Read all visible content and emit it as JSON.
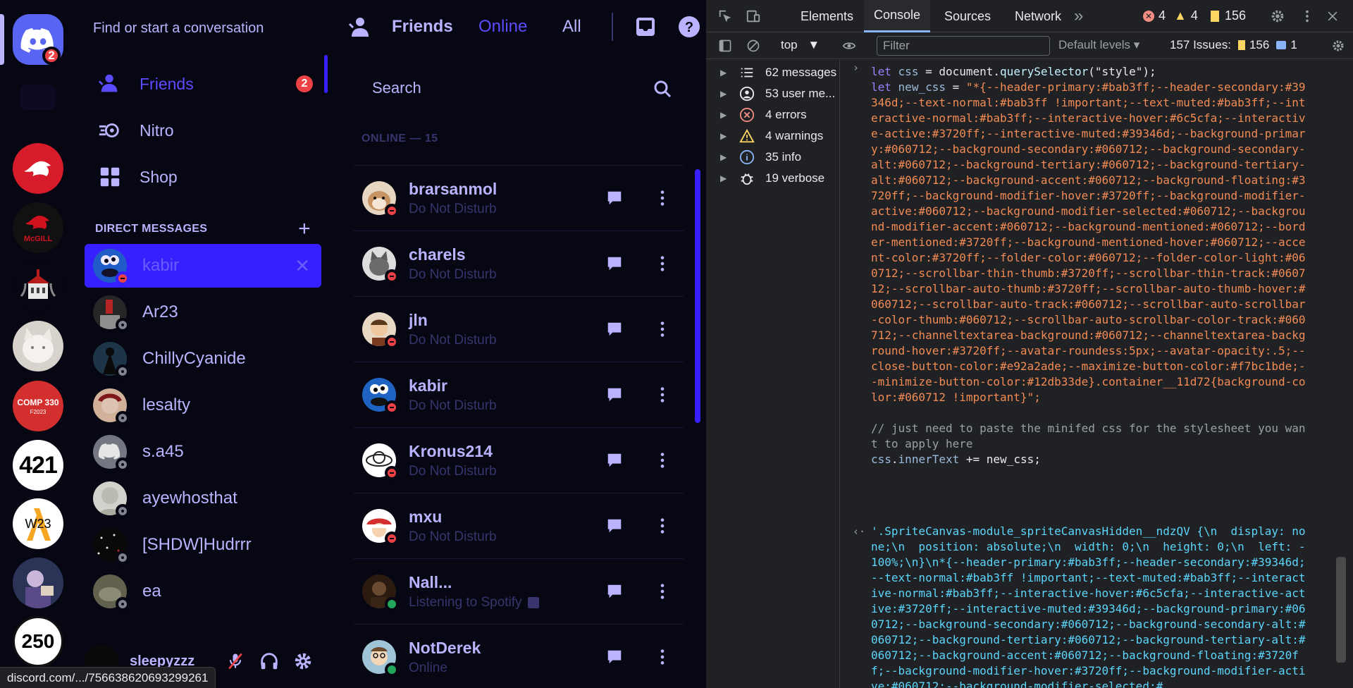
{
  "guilds": {
    "home_badge": "2",
    "comp_label": "COMP 330",
    "comp_sub": "F2023",
    "g421": "421",
    "w23": "W23",
    "g250": "250",
    "mcgill": "McGILL"
  },
  "channels": {
    "search_placeholder": "Find or start a conversation",
    "nav": [
      {
        "label": "Friends",
        "badge": "2"
      },
      {
        "label": "Nitro"
      },
      {
        "label": "Shop"
      }
    ],
    "dm_header": "DIRECT MESSAGES",
    "dm_add": "+",
    "dms": [
      {
        "name": "kabir",
        "status": "dnd",
        "selected": true
      },
      {
        "name": "Ar23",
        "status": "offline"
      },
      {
        "name": "ChillyCyanide",
        "status": "offline"
      },
      {
        "name": "lesalty",
        "status": "offline"
      },
      {
        "name": "s.a45",
        "status": "offline"
      },
      {
        "name": "ayewhosthat",
        "status": "offline"
      },
      {
        "name": "[SHDW]Hudrrr",
        "status": "offline"
      },
      {
        "name": "ea",
        "status": "offline"
      }
    ],
    "close_glyph": "✕"
  },
  "user_panel": {
    "username": "sleepyzzz"
  },
  "friends": {
    "title": "Friends",
    "tabs": [
      "Online",
      "All"
    ],
    "search_placeholder": "Search",
    "online_count_label": "ONLINE — 15",
    "list": [
      {
        "name": "brarsanmol",
        "status_text": "Do Not Disturb",
        "status": "dnd"
      },
      {
        "name": "charels",
        "status_text": "Do Not Disturb",
        "status": "dnd"
      },
      {
        "name": "jln",
        "status_text": "Do Not Disturb",
        "status": "dnd"
      },
      {
        "name": "kabir",
        "status_text": "Do Not Disturb",
        "status": "dnd"
      },
      {
        "name": "Kronus214",
        "status_text": "Do Not Disturb",
        "status": "dnd"
      },
      {
        "name": "mxu",
        "status_text": "Do Not Disturb",
        "status": "dnd"
      },
      {
        "name": "Nall...",
        "status_text": "Listening to Spotify",
        "status": "online"
      },
      {
        "name": "NotDerek",
        "status_text": "Online",
        "status": "online"
      }
    ]
  },
  "devtools": {
    "tabs": [
      "Elements",
      "Console",
      "Sources",
      "Network"
    ],
    "active_tab": "Console",
    "more_tabs": "»",
    "error_count": "4",
    "warning_count": "4",
    "issue_count": "156",
    "context": "top",
    "filter_placeholder": "Filter",
    "levels": "Default levels ▾",
    "issues_label": "157 Issues:",
    "issues_warn": "156",
    "issues_info": "1",
    "sidebar": [
      {
        "label": "62 messages",
        "icon": "list-icon"
      },
      {
        "label": "53 user me...",
        "icon": "user-icon"
      },
      {
        "label": "4 errors",
        "icon": "error-icon"
      },
      {
        "label": "4 warnings",
        "icon": "warning-icon"
      },
      {
        "label": "35 info",
        "icon": "info-icon"
      },
      {
        "label": "19 verbose",
        "icon": "bug-icon"
      }
    ],
    "code_line1_kw": "let",
    "code_line1_var": "css",
    "code_line1_rest": " = document.",
    "code_line1_fn": "querySelector",
    "code_line1_arg": "(\"style\");",
    "code_line2_kw": "let",
    "code_line2_var": "new_css",
    "code_line2_eq": " = ",
    "code_css_string": "\"*{--header-primary:#bab3ff;--header-secondary:#39346d;--text-normal:#bab3ff !important;--text-muted:#bab3ff;--interactive-normal:#bab3ff;--interactive-hover:#6c5cfa;--interactive-active:#3720ff;--interactive-muted:#39346d;--background-primary:#060712;--background-secondary:#060712;--background-secondary-alt:#060712;--background-tertiary:#060712;--background-tertiary-alt:#060712;--background-accent:#060712;--background-floating:#3720ff;--background-modifier-hover:#3720ff;--background-modifier-active:#060712;--background-modifier-selected:#060712;--background-modifier-accent:#060712;--background-mentioned:#060712;--border-mentioned:#3720ff;--background-mentioned-hover:#060712;--accent-color:#3720ff;--folder-color:#060712;--folder-color-light:#060712;--scrollbar-thin-thumb:#3720ff;--scrollbar-thin-track:#060712;--scrollbar-auto-thumb:#3720ff;--scrollbar-auto-thumb-hover:#060712;--scrollbar-auto-track:#060712;--scrollbar-auto-scrollbar-color-thumb:#060712;--scrollbar-auto-scrollbar-color-track:#060712;--channeltextarea-background:#060712;--channeltextarea-background-hover:#3720ff;--avatar-roundess:5px;--avatar-opacity:.5;--close-button-color:#e92a2ade;--maximize-button-color:#f7bc1bde;--minimize-button-color:#12db33de}.container__11d72{background-color:#060712 !important}\";",
    "code_comment": "// just need to paste the minifed css for the stylesheet you want to apply here",
    "code_last_var": "css",
    "code_last_dot": ".",
    "code_last_prop": "innerText",
    "code_last_rest": " += new_css;",
    "output": "'.SpriteCanvas-module_spriteCanvasHidden__ndzQV {\\n  display: none;\\n  position: absolute;\\n  width: 0;\\n  height: 0;\\n  left: -100%;\\n}\\n*{--header-primary:#bab3ff;--header-secondary:#39346d;--text-normal:#bab3ff !important;--text-muted:#bab3ff;--interactive-normal:#bab3ff;--interactive-hover:#6c5cfa;--interactive-active:#3720ff;--interactive-muted:#39346d;--background-primary:#060712;--background-secondary:#060712;--background-secondary-alt:#060712;--background-tertiary:#060712;--background-tertiary-alt:#060712;--background-accent:#060712;--background-floating:#3720ff;--background-modifier-hover:#3720ff;--background-modifier-active:#060712;--background-modifier-selected:#"
  },
  "status_url": "discord.com/.../756638620693299261",
  "colors": {
    "bg": "#060712",
    "text": "#bab3ff",
    "muted": "#39346d",
    "accent": "#3720ff",
    "hover": "#6c5cfa",
    "blurple": "#5865f2"
  }
}
